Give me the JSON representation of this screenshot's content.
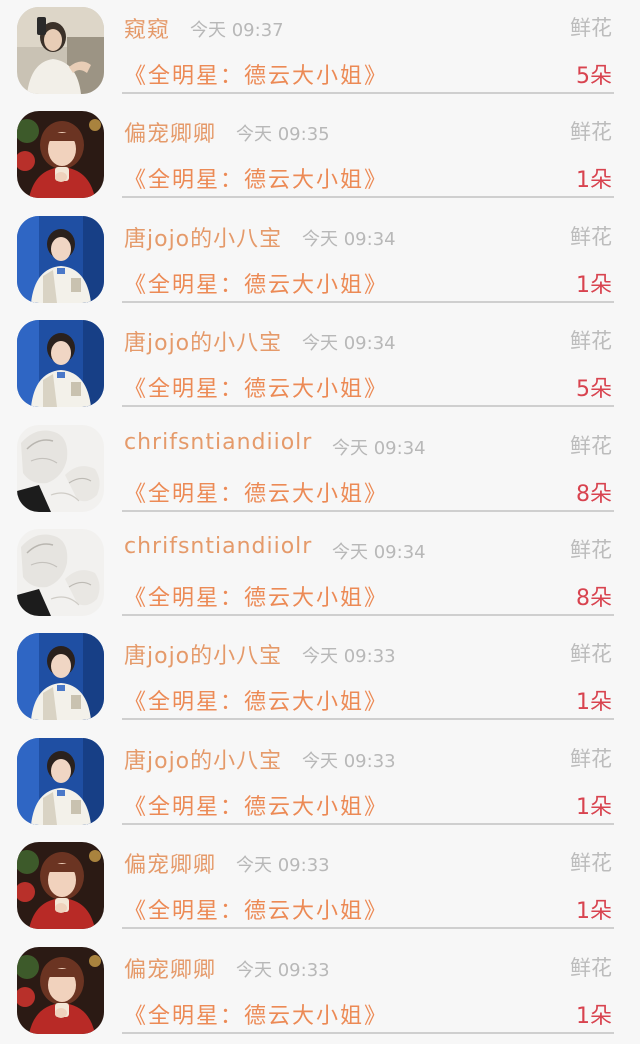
{
  "colors": {
    "name": "#e59a6a",
    "time": "#b8b8b8",
    "gift": "#bcbcbc",
    "title": "#ec8a55",
    "count": "#d8434f",
    "divider": "#cfcfcf",
    "background": "#f7f7f7"
  },
  "records": [
    {
      "avatar": "avatar-selfie",
      "name": "窥窥",
      "time": "今天 09:37",
      "gift": "鲜花",
      "title": "《全明星：德云大小姐》",
      "count": "5朵"
    },
    {
      "avatar": "avatar-girl-red",
      "name": "偏宠卿卿",
      "time": "今天 09:35",
      "gift": "鲜花",
      "title": "《全明星：德云大小姐》",
      "count": "1朵"
    },
    {
      "avatar": "avatar-boy-blue",
      "name": "唐jojo的小八宝",
      "time": "今天 09:34",
      "gift": "鲜花",
      "title": "《全明星：德云大小姐》",
      "count": "1朵"
    },
    {
      "avatar": "avatar-boy-blue",
      "name": "唐jojo的小八宝",
      "time": "今天 09:34",
      "gift": "鲜花",
      "title": "《全明星：德云大小姐》",
      "count": "5朵"
    },
    {
      "avatar": "avatar-sketch",
      "name": "chrifsntiandiiolr",
      "time": "今天 09:34",
      "gift": "鲜花",
      "title": "《全明星：德云大小姐》",
      "count": "8朵"
    },
    {
      "avatar": "avatar-sketch",
      "name": "chrifsntiandiiolr",
      "time": "今天 09:34",
      "gift": "鲜花",
      "title": "《全明星：德云大小姐》",
      "count": "8朵"
    },
    {
      "avatar": "avatar-boy-blue",
      "name": "唐jojo的小八宝",
      "time": "今天 09:33",
      "gift": "鲜花",
      "title": "《全明星：德云大小姐》",
      "count": "1朵"
    },
    {
      "avatar": "avatar-boy-blue",
      "name": "唐jojo的小八宝",
      "time": "今天 09:33",
      "gift": "鲜花",
      "title": "《全明星：德云大小姐》",
      "count": "1朵"
    },
    {
      "avatar": "avatar-girl-red",
      "name": "偏宠卿卿",
      "time": "今天 09:33",
      "gift": "鲜花",
      "title": "《全明星：德云大小姐》",
      "count": "1朵"
    },
    {
      "avatar": "avatar-girl-red",
      "name": "偏宠卿卿",
      "time": "今天 09:33",
      "gift": "鲜花",
      "title": "《全明星：德云大小姐》",
      "count": "1朵"
    }
  ]
}
